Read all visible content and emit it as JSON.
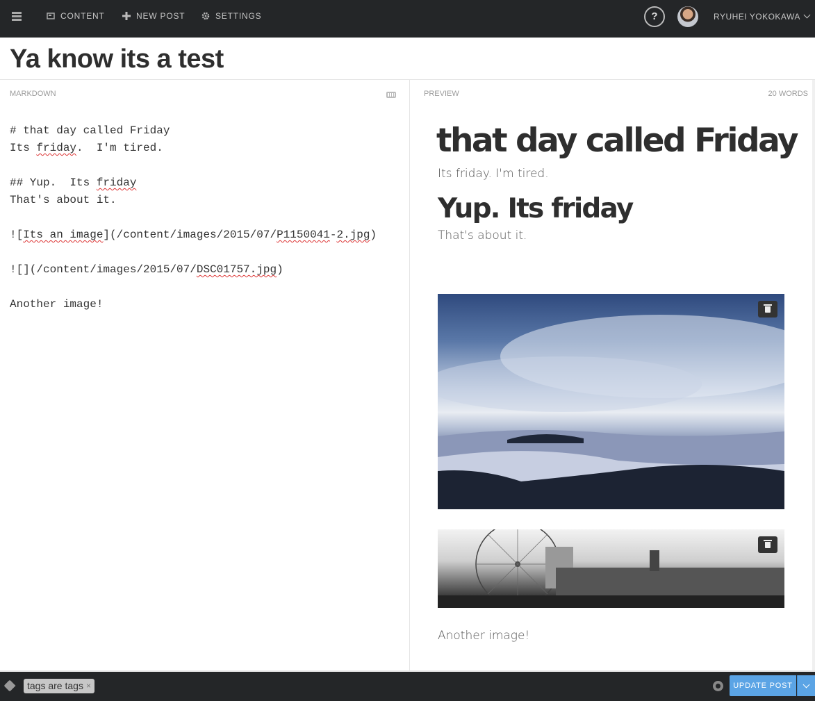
{
  "nav": {
    "content_label": "CONTENT",
    "new_post_label": "NEW POST",
    "settings_label": "SETTINGS",
    "help_label": "?",
    "user_name": "RYUHEI YOKOKAWA"
  },
  "post": {
    "title": "Ya know its a test"
  },
  "editor": {
    "header_label": "MARKDOWN",
    "lines": {
      "l1": "# that day called Friday",
      "l2a": "Its ",
      "l2b": "friday",
      "l2c": ".  I'm tired.",
      "l4a": "## Yup.  Its ",
      "l4b": "friday",
      "l5": "That's about it.",
      "l7a": "![",
      "l7b": "Its an image",
      "l7c": "](/content/images/2015/07/",
      "l7d": "P1150041",
      "l7e": "-",
      "l7f": "2.jpg",
      "l7g": ")",
      "l9a": "![](/content/images/2015/07/",
      "l9b": "DSC01757.jpg",
      "l9c": ")",
      "l11": "Another image!"
    }
  },
  "preview": {
    "header_label": "PREVIEW",
    "word_count": "20 WORDS",
    "h1": "that day called Friday",
    "p1": "Its friday. I'm tired.",
    "h2": "Yup. Its friday",
    "p2": "That's about it.",
    "p3": "Another image!"
  },
  "footer": {
    "tag_label": "tags are tags",
    "tag_remove": "×",
    "update_label": "UPDATE POST"
  },
  "colors": {
    "nav_bg": "#242628",
    "accent_blue": "#5ba4e5"
  }
}
